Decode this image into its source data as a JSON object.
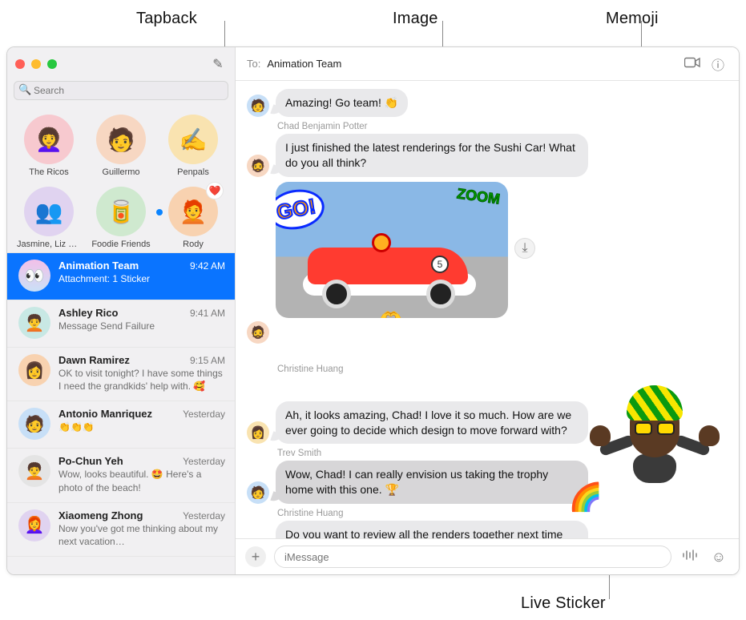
{
  "callouts": {
    "tapback": "Tapback",
    "image": "Image",
    "memoji": "Memoji",
    "live_sticker": "Live Sticker"
  },
  "window": {
    "search_placeholder": "Search",
    "to_label": "To:",
    "to_name": "Animation Team",
    "message_placeholder": "iMessage"
  },
  "icons": {
    "compose": "✎",
    "search": "🔍",
    "video": "📹",
    "info": "ⓘ",
    "download": "⤓",
    "plus": "+",
    "mic": "⋮⋮⋮",
    "emoji": "☺"
  },
  "pinned": [
    {
      "name": "The Ricos",
      "avatar_class": "bg-pink",
      "glyph": "👩‍🦱"
    },
    {
      "name": "Guillermo",
      "avatar_class": "bg-peach",
      "glyph": "🧑"
    },
    {
      "name": "Penpals",
      "avatar_class": "bg-yellow",
      "glyph": "✍️"
    },
    {
      "name": "Jasmine, Liz &…",
      "avatar_class": "bg-lav",
      "glyph": "👥"
    },
    {
      "name": "Foodie Friends",
      "avatar_class": "bg-green",
      "glyph": "🥫"
    },
    {
      "name": "Rody",
      "avatar_class": "bg-orange",
      "glyph": "🧑‍🦰",
      "unread": true,
      "tapback": "❤️"
    }
  ],
  "conversations": [
    {
      "name": "Animation Team",
      "time": "9:42 AM",
      "preview": "Attachment: 1 Sticker",
      "avatar_class": "bg-grad1",
      "glyph": "👀",
      "selected": true
    },
    {
      "name": "Ashley Rico",
      "time": "9:41 AM",
      "preview": "Message Send Failure",
      "avatar_class": "bg-teal",
      "glyph": "🧑‍🦱"
    },
    {
      "name": "Dawn Ramirez",
      "time": "9:15 AM",
      "preview": "OK to visit tonight? I have some things I need the grandkids' help with. 🥰",
      "avatar_class": "bg-orange",
      "glyph": "👩"
    },
    {
      "name": "Antonio Manriquez",
      "time": "Yesterday",
      "preview": "👏👏👏",
      "avatar_class": "bg-blue",
      "glyph": "🧑"
    },
    {
      "name": "Po-Chun Yeh",
      "time": "Yesterday",
      "preview": "Wow, looks beautiful. 🤩 Here's a photo of the beach!",
      "avatar_class": "bg-gray",
      "glyph": "🧑‍🦱"
    },
    {
      "name": "Xiaomeng Zhong",
      "time": "Yesterday",
      "preview": "Now you've got me thinking about my next vacation…",
      "avatar_class": "bg-lav",
      "glyph": "👩‍🦰"
    }
  ],
  "thread": {
    "m0_sender": "Trev Smith",
    "m0_text": "Amazing! Go team! 👏",
    "m1_sender": "Chad Benjamin Potter",
    "m1_text": "I just finished the latest renderings for the Sushi Car! What do you all think?",
    "image_go": "GO!",
    "image_zoom": "ZOOM",
    "image_number": "5",
    "image_hands": "🫶",
    "m3_sender": "Christine Huang",
    "m3_text": "Ah, it looks amazing, Chad! I love it so much. How are we ever going to decide which design to move forward with?",
    "m4_sender": "Trev Smith",
    "m4_text": "Wow, Chad! I can really envision us taking the trophy home with this one. 🏆",
    "m5_sender": "Christine Huang",
    "m5_text": "Do you want to review all the renders together next time we meet and decide on our favorites? We have so much amazing work now, just need to make some decisions.",
    "rainbow": "🌈"
  }
}
